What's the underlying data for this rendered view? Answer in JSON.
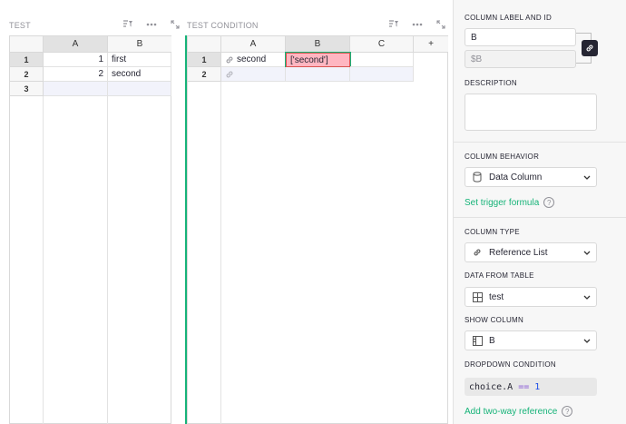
{
  "widget_left": {
    "title": "TEST",
    "columns": [
      "A",
      "B"
    ],
    "rows": [
      {
        "num": "1",
        "a": "1",
        "b": "first"
      },
      {
        "num": "2",
        "a": "2",
        "b": "second"
      },
      {
        "num": "3",
        "a": "",
        "b": ""
      }
    ]
  },
  "widget_right": {
    "title": "TEST CONDITION",
    "columns": [
      "A",
      "B",
      "C"
    ],
    "add_column": "+",
    "rows": [
      {
        "num": "1",
        "a": "second",
        "b": "['second']",
        "c": ""
      },
      {
        "num": "2",
        "a": "",
        "b": "",
        "c": ""
      }
    ]
  },
  "panel": {
    "column_label_title": "COLUMN LABEL AND ID",
    "label_value": "B",
    "id_value": "$B",
    "description_title": "DESCRIPTION",
    "behavior_title": "COLUMN BEHAVIOR",
    "behavior_value": "Data Column",
    "trigger_link": "Set trigger formula",
    "type_title": "COLUMN TYPE",
    "type_value": "Reference List",
    "from_table_title": "DATA FROM TABLE",
    "from_table_value": "test",
    "show_column_title": "SHOW COLUMN",
    "show_column_value": "B",
    "dropdown_title": "DROPDOWN CONDITION",
    "dropdown_code": {
      "obj": "choice",
      "attr": ".A",
      "op": " == ",
      "num": "1"
    },
    "two_way_link": "Add two-way reference",
    "help_mark": "?"
  },
  "colors": {
    "accent": "#16b378",
    "error_cell": "#ffb6c1",
    "selected_header": "#e2e2e2"
  }
}
